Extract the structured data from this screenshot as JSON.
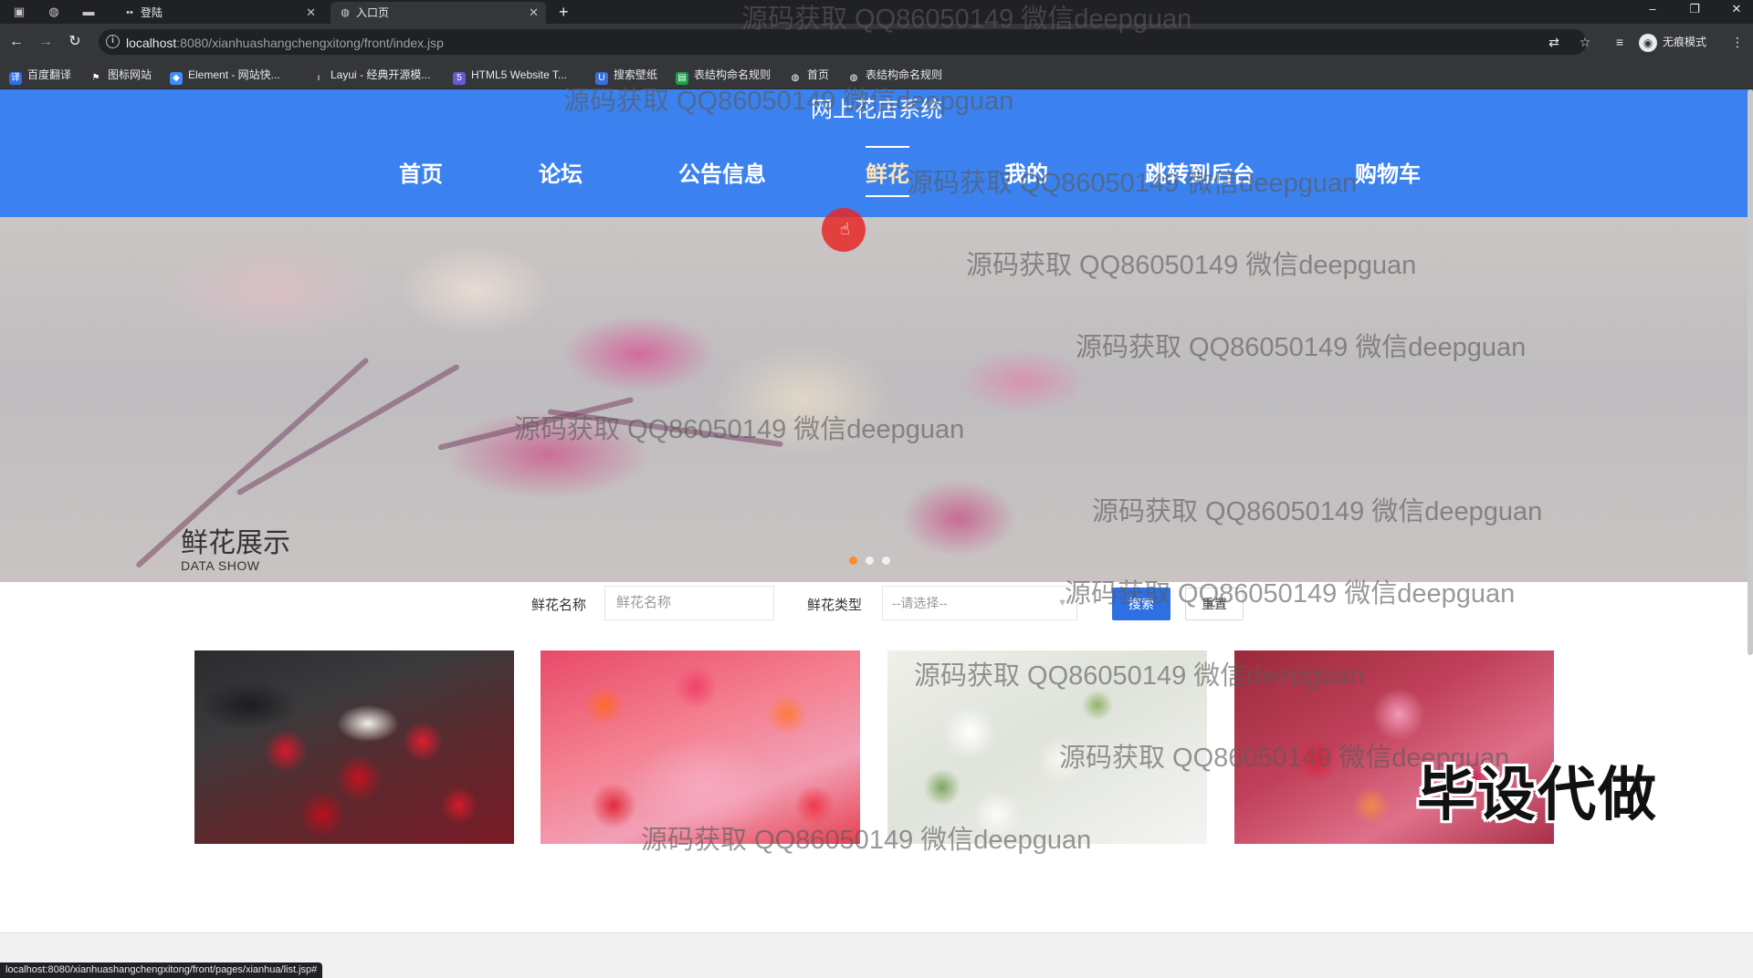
{
  "browser": {
    "tabs": [
      {
        "title": "登陆",
        "active": false
      },
      {
        "title": "入口页",
        "active": true
      }
    ],
    "url_host": "localhost",
    "url_path": ":8080/xianhuashangchengxitong/front/index.jsp",
    "profile_label": "无痕模式",
    "bookmarks": [
      {
        "label": "百度翻译",
        "icon": "translate-icon"
      },
      {
        "label": "图标网站",
        "icon": "flag-icon"
      },
      {
        "label": "Element - 网站快...",
        "icon": "element-icon"
      },
      {
        "label": "Layui - 经典开源模...",
        "icon": "layui-icon"
      },
      {
        "label": "HTML5 Website T...",
        "icon": "html5-icon"
      },
      {
        "label": "搜索壁纸",
        "icon": "wallpaper-icon"
      },
      {
        "label": "表结构命名规则",
        "icon": "sheet-icon"
      },
      {
        "label": "首页",
        "icon": "globe-icon"
      },
      {
        "label": "表结构命名规则",
        "icon": "globe-icon"
      }
    ],
    "status_url": "localhost:8080/xianhuashangchengxitong/front/pages/xianhua/list.jsp#"
  },
  "site": {
    "title": "网上花店系统",
    "nav": [
      {
        "label": "首页",
        "active": false
      },
      {
        "label": "论坛",
        "active": false
      },
      {
        "label": "公告信息",
        "active": false
      },
      {
        "label": "鲜花",
        "active": true
      },
      {
        "label": "我的",
        "active": false
      },
      {
        "label": "跳转到后台",
        "active": false
      },
      {
        "label": "购物车",
        "active": false
      }
    ]
  },
  "carousel": {
    "slide_count": 3,
    "active_index": 0
  },
  "section": {
    "title": "鲜花展示",
    "subtitle": "DATA SHOW"
  },
  "search": {
    "name_label": "鲜花名称",
    "name_placeholder": "鲜花名称",
    "type_label": "鲜花类型",
    "type_value": "--请选择--",
    "search_button": "搜索",
    "reset_button": "重置"
  },
  "products": [
    {
      "image": "red-rose-lily-bouquet"
    },
    {
      "image": "pink-orange-rose-box"
    },
    {
      "image": "white-lisianthus-bouquet"
    },
    {
      "image": "pink-mixed-bouquet"
    }
  ],
  "overlay": {
    "watermark": "源码获取 QQ86050149 微信deepguan",
    "promo": "毕设代做"
  },
  "colors": {
    "header_blue": "#3b82f0",
    "active_nav": "#ffe4b8",
    "search_button": "#2f6fe4",
    "dot_active": "#ff8c2b"
  }
}
